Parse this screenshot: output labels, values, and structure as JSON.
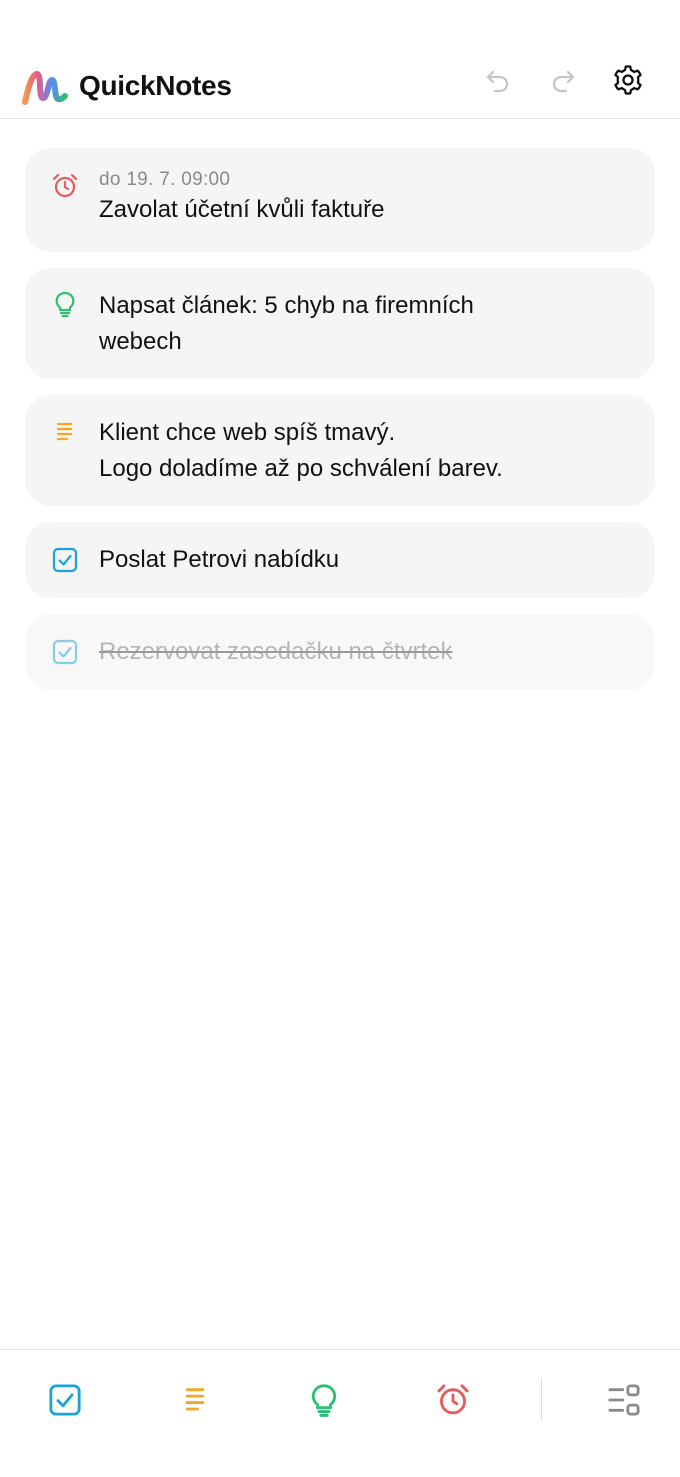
{
  "app": {
    "title": "QuickNotes",
    "logo_icon": "quicknotes-logo-icon"
  },
  "header": {
    "undo_icon": "undo-icon",
    "redo_icon": "redo-icon",
    "settings_icon": "gear-icon"
  },
  "notes": [
    {
      "type": "reminder",
      "icon": "alarm-clock-icon",
      "color": "#e85a5a",
      "meta": "do 19. 7. 09:00",
      "text": "Zavolat účetní kvůli faktuře"
    },
    {
      "type": "idea",
      "icon": "lightbulb-icon",
      "color": "#2fbf71",
      "text": "Napsat článek: 5 chyb na firemních webech"
    },
    {
      "type": "note",
      "icon": "lines-icon",
      "color": "#f5a623",
      "text": "Klient chce web spíš tmavý.\nLogo doladíme až po schválení barev."
    },
    {
      "type": "task",
      "icon": "checkbox-icon",
      "color": "#1aa3d9",
      "done": false,
      "text": "Poslat Petrovi nabídku"
    },
    {
      "type": "task",
      "icon": "checkbox-icon",
      "color": "#1aa3d9",
      "done": true,
      "text": "Rezervovat zasedačku na čtvrtek"
    }
  ],
  "bottom_nav": [
    {
      "icon": "checkbox-icon",
      "color": "#1aa3d9"
    },
    {
      "icon": "lines-icon",
      "color": "#f5a623"
    },
    {
      "icon": "lightbulb-icon",
      "color": "#2fbf71"
    },
    {
      "icon": "alarm-clock-icon",
      "color": "#e85a5a"
    },
    {
      "icon": "view-layout-icon",
      "color": "#8a8a8a"
    }
  ]
}
